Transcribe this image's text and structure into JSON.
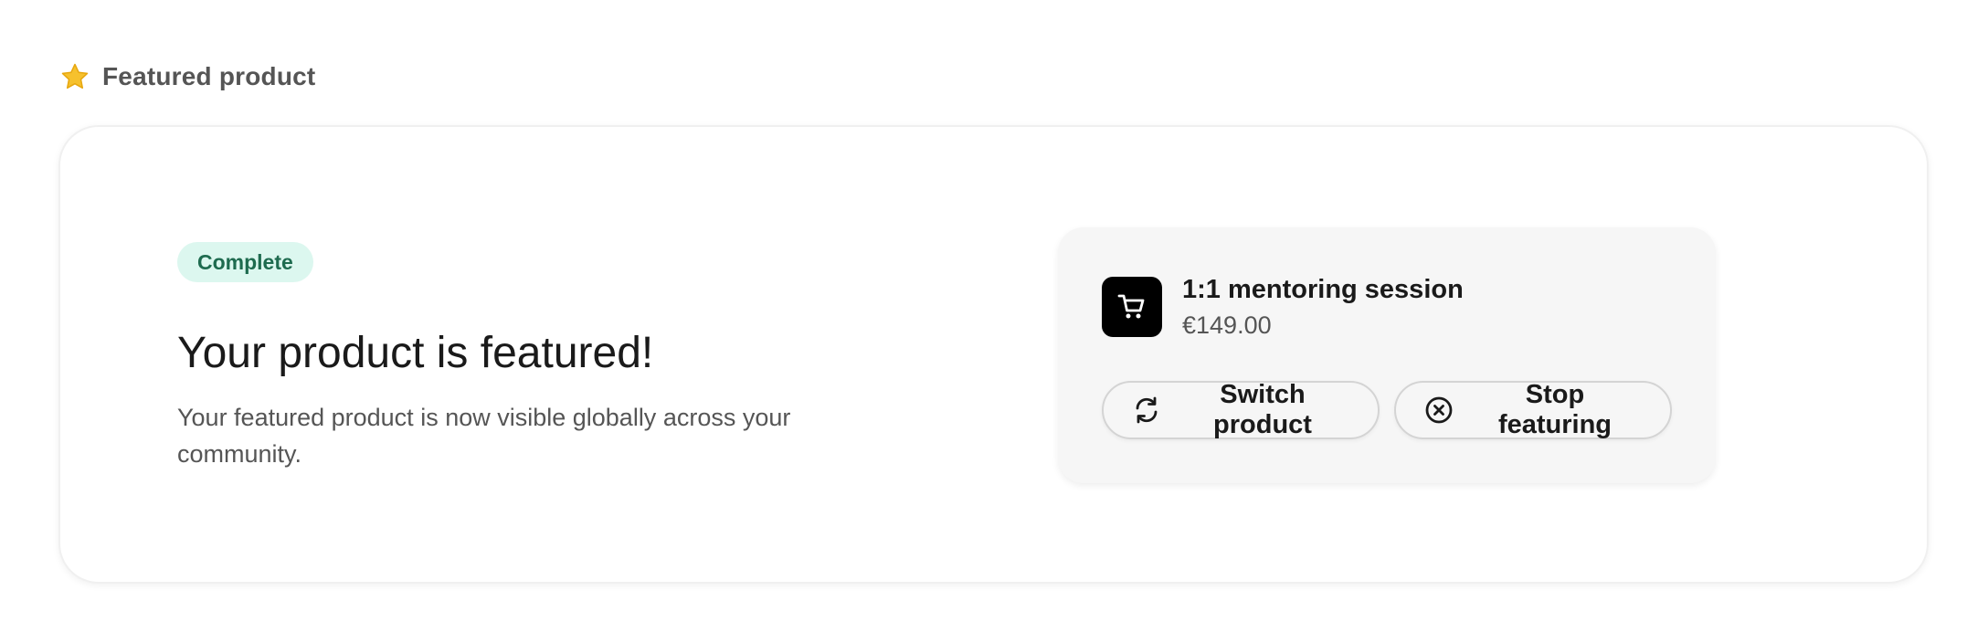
{
  "section": {
    "icon": "star-icon",
    "title": "Featured product"
  },
  "status": {
    "badge": "Complete",
    "headline": "Your product is featured!",
    "description": "Your featured product is now visible globally across your community."
  },
  "product": {
    "icon": "shopping-cart-icon",
    "name": "1:1 mentoring session",
    "price": "€149.00"
  },
  "actions": {
    "switch_label": "Switch product",
    "switch_icon": "refresh-icon",
    "stop_label": "Stop featuring",
    "stop_icon": "close-circle-icon"
  },
  "colors": {
    "badge_bg": "#dcf7ef",
    "badge_text": "#1e6b4f",
    "star": "#f6c12d",
    "product_thumb": "#000000"
  }
}
